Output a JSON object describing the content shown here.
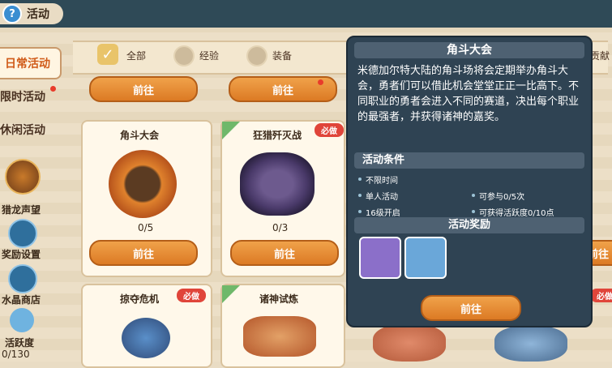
{
  "header": {
    "title": "活动"
  },
  "sidebar": {
    "tabs": [
      {
        "label": "日常活动",
        "active": true
      },
      {
        "label": "限时活动"
      },
      {
        "label": "休闲活动"
      }
    ],
    "items": [
      {
        "label": "猎龙声望",
        "icon": "dragon-emblem-icon"
      },
      {
        "label": "奖励设置",
        "icon": "gear-icon"
      },
      {
        "label": "水晶商店",
        "icon": "crystal-icon"
      }
    ],
    "activity": {
      "label": "活跃度",
      "value": "0/130"
    }
  },
  "filters": [
    {
      "label": "全部",
      "active": true
    },
    {
      "label": "经验"
    },
    {
      "label": "装备"
    },
    {
      "label": "贡献"
    }
  ],
  "common": {
    "go_label": "前往",
    "must_badge": "必做"
  },
  "cards": [
    {
      "title": "角斗大会",
      "count": "0/5"
    },
    {
      "title": "狂猎歼灭战",
      "count": "0/3",
      "must": true
    },
    {
      "title": "掠夺危机",
      "must": true
    },
    {
      "title": "诸神试炼"
    }
  ],
  "popup": {
    "title": "角斗大会",
    "description": "米德加尔特大陆的角斗场将会定期举办角斗大会，勇者们可以借此机会堂堂正正一比高下。不同职业的勇者会进入不同的赛道，决出每个职业的最强者，并获得诸神的嘉奖。",
    "conditions_title": "活动条件",
    "conditions": [
      "不限时间",
      "单人活动",
      "可参与0/5次",
      "16级开启",
      "可获得活跃度0/10点"
    ],
    "rewards_title": "活动奖励",
    "button": "前往"
  },
  "colors": {
    "accent": "#dc7a24",
    "panel": "#2f4353",
    "must": "#e0453a"
  }
}
